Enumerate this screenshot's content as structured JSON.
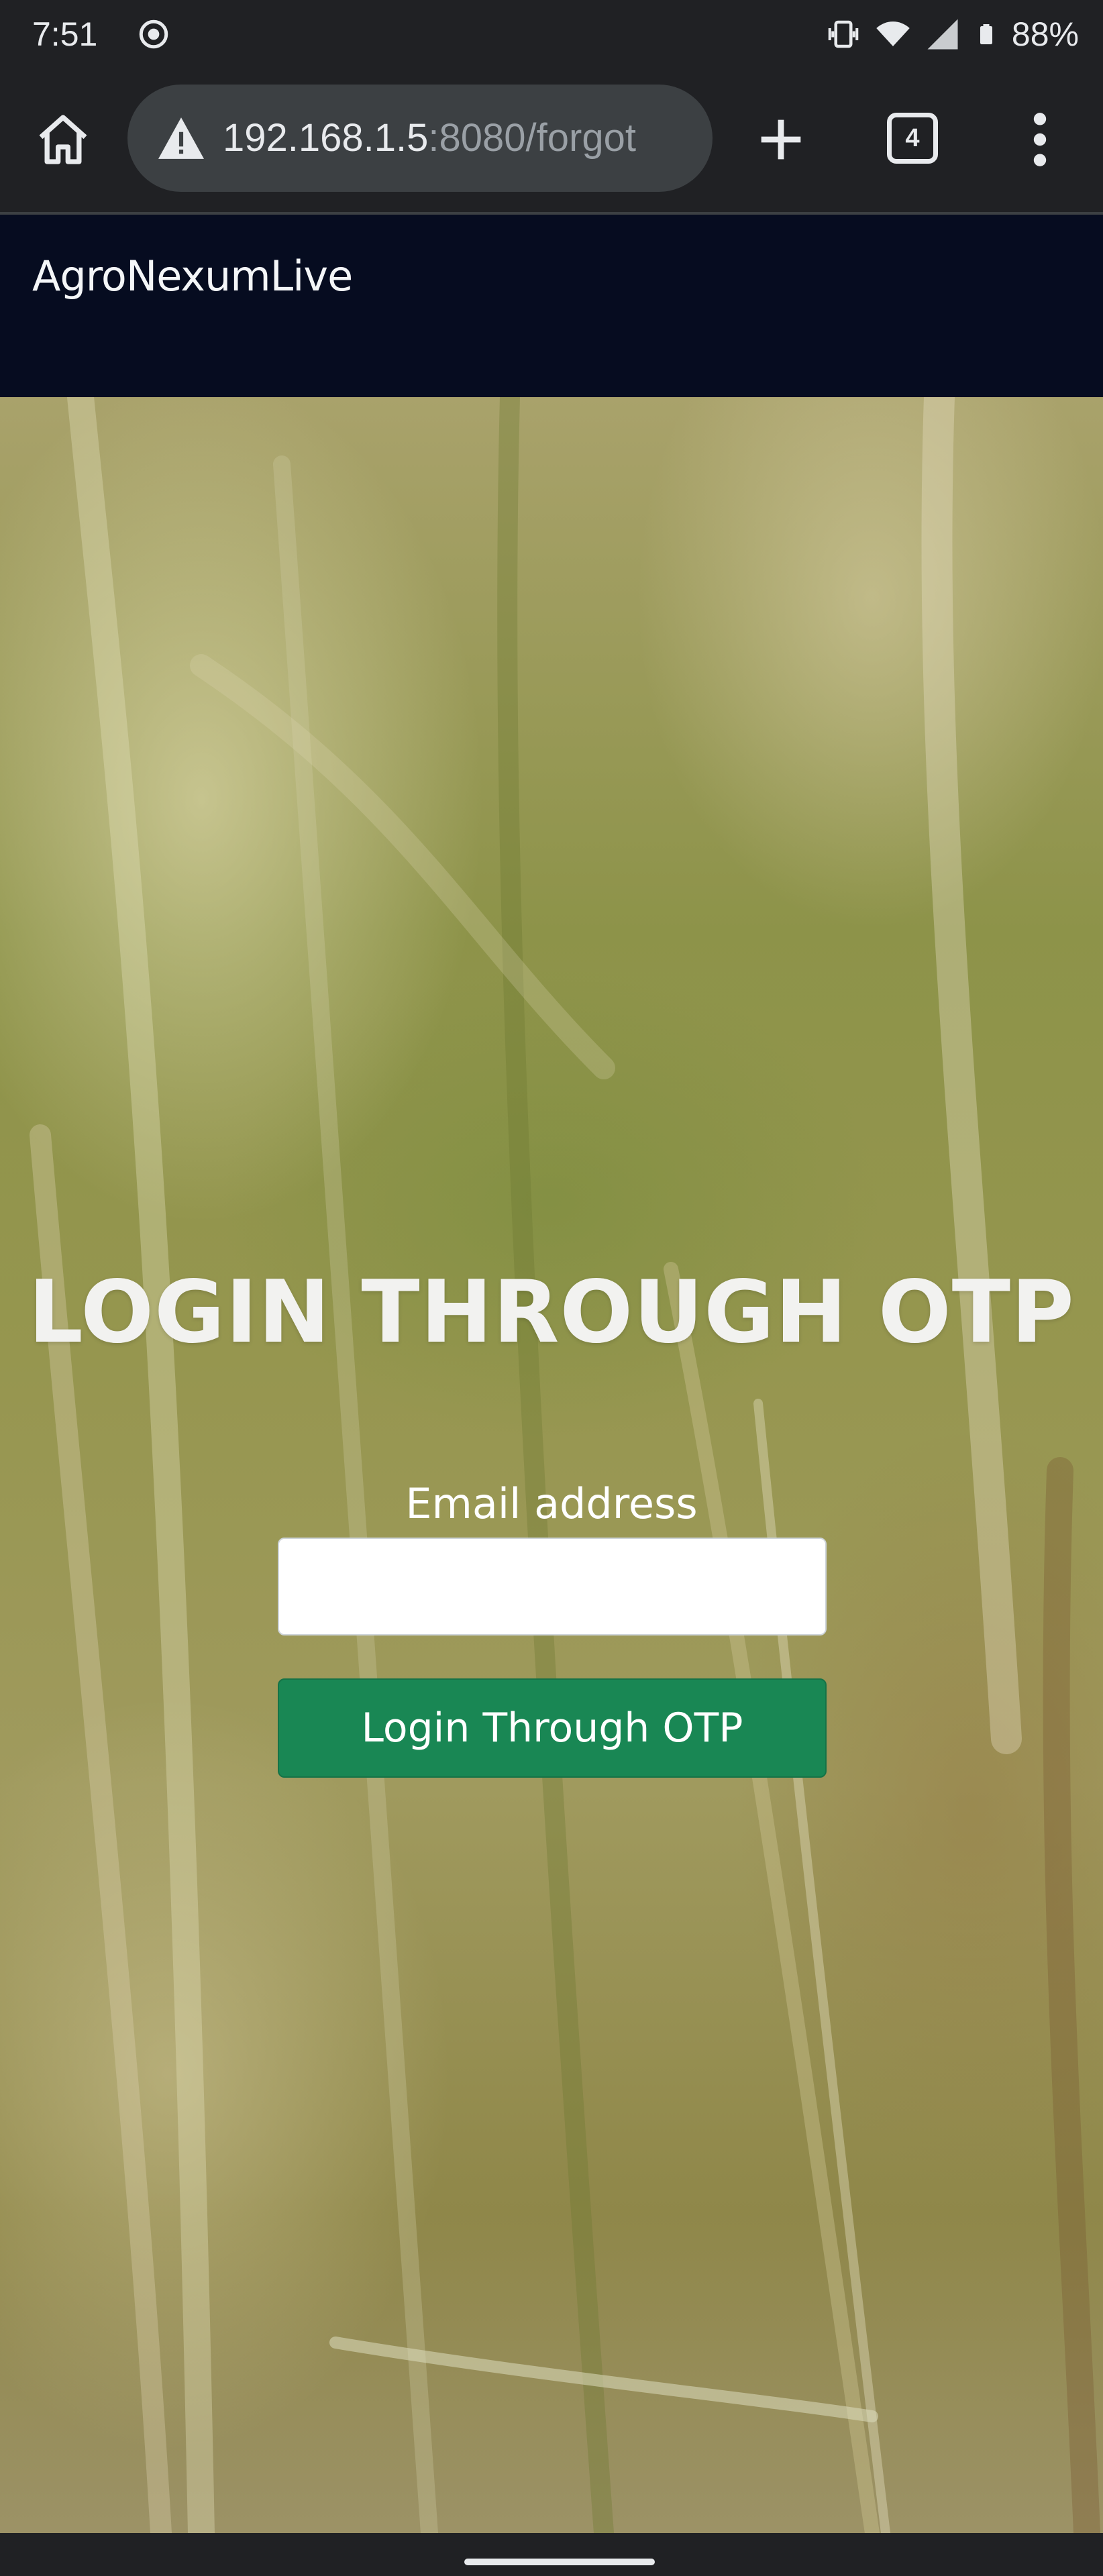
{
  "status_bar": {
    "time": "7:51",
    "battery": "88%",
    "icons": [
      "screen-record-icon",
      "vibrate-icon",
      "wifi-icon",
      "signal-icon",
      "battery-icon"
    ]
  },
  "browser": {
    "url_host": "192.168.1.5",
    "url_path": ":8080/forgot",
    "tab_count": "4",
    "icons": [
      "home-icon",
      "not-secure-warning-icon",
      "new-tab-icon",
      "tab-switcher-icon",
      "menu-icon"
    ]
  },
  "site": {
    "brand": "AgroNexumLive"
  },
  "form": {
    "title": "LOGIN THROUGH OTP",
    "email_label": "Email address",
    "email_value": "",
    "submit_label": "Login Through OTP"
  },
  "colors": {
    "navbar": "#060c20",
    "button": "#198754",
    "chrome": "#202124"
  }
}
